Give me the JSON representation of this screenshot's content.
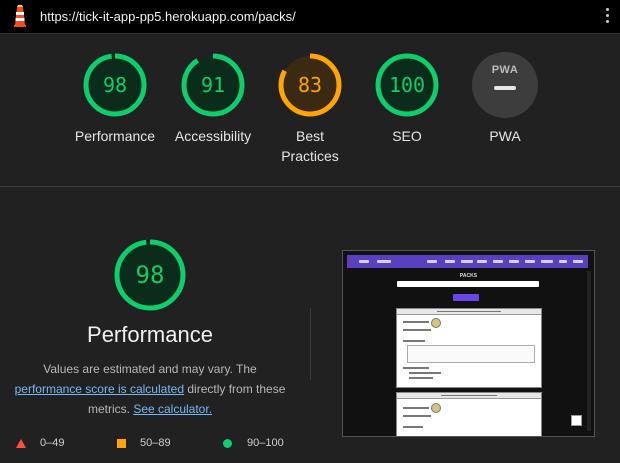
{
  "browser": {
    "url": "https://tick-it-app-pp5.herokuapp.com/packs/"
  },
  "colors": {
    "pass": "#0cce6b",
    "average": "#ffa400",
    "fail": "#ff4e42",
    "pwa_gray": "#3d3d3d"
  },
  "summary": {
    "categories": [
      {
        "label": "Performance",
        "score": "98",
        "score_value": 98,
        "rating": "pass"
      },
      {
        "label": "Accessibility",
        "score": "91",
        "score_value": 91,
        "rating": "pass"
      },
      {
        "label": "Best Practices",
        "label_line1": "Best",
        "label_line2": "Practices",
        "score": "83",
        "score_value": 83,
        "rating": "average"
      },
      {
        "label": "SEO",
        "score": "100",
        "score_value": 100,
        "rating": "pass"
      },
      {
        "label": "PWA",
        "badge_text": "PWA",
        "rating": "none"
      }
    ]
  },
  "performance": {
    "score": "98",
    "score_value": 98,
    "title": "Performance",
    "desc_part1": "Values are estimated and may vary. The",
    "desc_link1": "performance score is calculated",
    "desc_part2": "directly from these metrics.",
    "desc_link2": "See calculator."
  },
  "legend": [
    {
      "icon": "triangle",
      "range": "0–49"
    },
    {
      "icon": "square",
      "range": "50–89"
    },
    {
      "icon": "circle",
      "range": "90–100"
    }
  ],
  "screenshot_thumbnail": {
    "page_heading": "PACKS",
    "icon": "page-screenshot"
  }
}
